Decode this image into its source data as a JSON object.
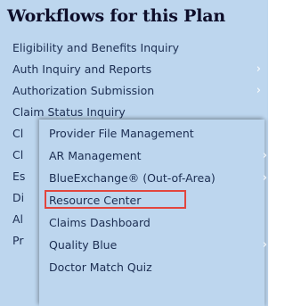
{
  "panel": {
    "title": "Workflows for this Plan",
    "items": [
      {
        "label": "Eligibility and Benefits Inquiry",
        "has_submenu": false
      },
      {
        "label": "Auth Inquiry and Reports",
        "has_submenu": true
      },
      {
        "label": "Authorization Submission",
        "has_submenu": true
      },
      {
        "label": "Claim Status Inquiry",
        "has_submenu": false
      },
      {
        "label": "Cl",
        "has_submenu": false
      },
      {
        "label": "Cl",
        "has_submenu": false
      },
      {
        "label": "Es",
        "has_submenu": false
      },
      {
        "label": "Di",
        "has_submenu": false
      },
      {
        "label": "Al",
        "has_submenu": false
      },
      {
        "label": "Pr",
        "has_submenu": false
      }
    ]
  },
  "flyout": {
    "items": [
      {
        "label": "Provider File Management",
        "has_submenu": false,
        "highlighted": false
      },
      {
        "label": "AR Management",
        "has_submenu": true,
        "highlighted": false
      },
      {
        "label": "BlueExchange® (Out-of-Area)",
        "has_submenu": true,
        "highlighted": false
      },
      {
        "label": "Resource Center",
        "has_submenu": false,
        "highlighted": true
      },
      {
        "label": "Claims Dashboard",
        "has_submenu": false,
        "highlighted": false
      },
      {
        "label": "Quality Blue",
        "has_submenu": true,
        "highlighted": false
      },
      {
        "label": "Doctor Match Quiz",
        "has_submenu": false,
        "highlighted": false
      }
    ]
  },
  "chevron_glyph": "›",
  "colors": {
    "panel_bg": "#bdd6ee",
    "text": "#1c2e52",
    "title": "#0e0e2a",
    "highlight_border": "#e2453d",
    "chevron": "#ffffff"
  }
}
